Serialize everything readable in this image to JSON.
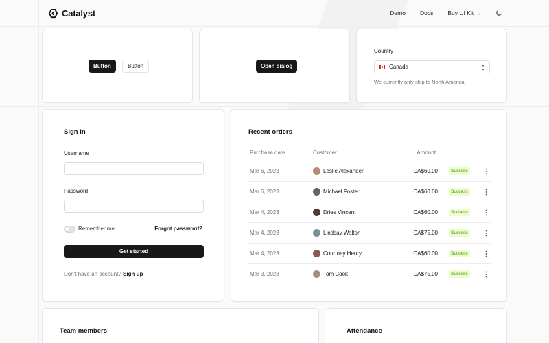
{
  "header": {
    "brand": "Catalyst",
    "nav": [
      "Demo",
      "Docs",
      "Buy UI Kit →"
    ]
  },
  "buttons_card": {
    "primary": "Button",
    "secondary": "Button"
  },
  "dialog_card": {
    "open_label": "Open dialog"
  },
  "country_card": {
    "label": "Country",
    "value": "Canada",
    "helper": "We currently only ship to North America."
  },
  "signin": {
    "title": "Sign in",
    "username_label": "Username",
    "username_value": "",
    "password_label": "Password",
    "password_value": "",
    "remember_label": "Remember me",
    "forgot_label": "Forgot password?",
    "submit_label": "Get started",
    "no_account": "Don't have an account?",
    "signup_label": "Sign up"
  },
  "orders": {
    "title": "Recent orders",
    "columns": [
      "Purchase date",
      "Customer",
      "Amount"
    ],
    "rows": [
      {
        "date": "Mar 6, 2023",
        "customer": "Leslie Alexander",
        "amount": "CA$60.00",
        "status": "Success"
      },
      {
        "date": "Mar 6, 2023",
        "customer": "Michael Foster",
        "amount": "CA$60.00",
        "status": "Success"
      },
      {
        "date": "Mar 4, 2023",
        "customer": "Dries Vincent",
        "amount": "CA$60.00",
        "status": "Success"
      },
      {
        "date": "Mar 4, 2023",
        "customer": "Lindsay Walton",
        "amount": "CA$75.00",
        "status": "Success"
      },
      {
        "date": "Mar 4, 2023",
        "customer": "Courtney Henry",
        "amount": "CA$60.00",
        "status": "Success"
      },
      {
        "date": "Mar 3, 2023",
        "customer": "Tom Cook",
        "amount": "CA$75.00",
        "status": "Success"
      }
    ]
  },
  "team": {
    "title": "Team members"
  },
  "attendance": {
    "title": "Attendance"
  },
  "colors": {
    "primary_button": "#18181b",
    "success_bg": "#ecfccb",
    "success_text": "#3f8a1f",
    "page_bg": "#fafafa"
  },
  "icons": [
    "catalyst-logo-icon",
    "moon-icon",
    "canada-flag-icon",
    "chevron-up-down-icon",
    "more-vertical-icon"
  ]
}
